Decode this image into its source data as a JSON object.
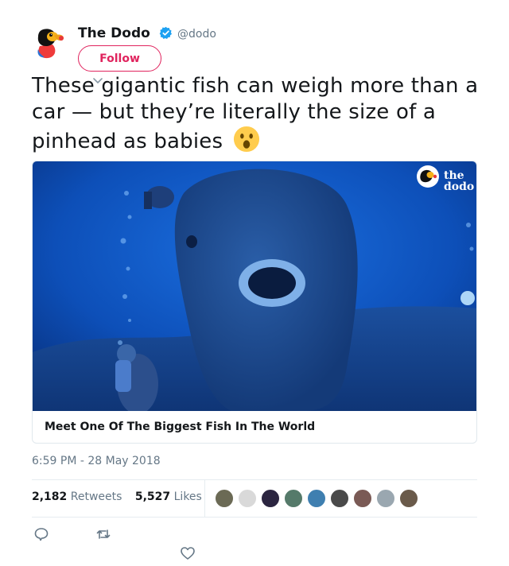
{
  "user": {
    "name": "The Dodo",
    "handle": "@dodo",
    "follow_label": "Follow"
  },
  "tweet": {
    "text": "These gigantic fish can weigh more than a car — but they’re literally the size of a pinhead as babies",
    "emoji": "astonished-face-emoji"
  },
  "card": {
    "title": "Meet One Of The Biggest Fish In The World",
    "watermark": "the dodo"
  },
  "meta": {
    "timestamp": "6:59 PM - 28 May 2018",
    "retweets_count": "2,182",
    "retweets_label": "Retweets",
    "likes_count": "5,527",
    "likes_label": "Likes"
  },
  "likers": [
    {
      "name": "liker-avatar-1",
      "color": "#6b6a55"
    },
    {
      "name": "liker-avatar-2",
      "color": "#d9d9d9"
    },
    {
      "name": "liker-avatar-3",
      "color": "#2b2540"
    },
    {
      "name": "liker-avatar-4",
      "color": "#557a6a"
    },
    {
      "name": "liker-avatar-5",
      "color": "#3f7fb0"
    },
    {
      "name": "liker-avatar-6",
      "color": "#4a4a4a"
    },
    {
      "name": "liker-avatar-7",
      "color": "#7a5a55"
    },
    {
      "name": "liker-avatar-8",
      "color": "#9aa7b0"
    },
    {
      "name": "liker-avatar-9",
      "color": "#6a5a4a"
    }
  ],
  "icons": {
    "reply": "reply-icon",
    "retweet": "retweet-icon",
    "like": "heart-icon"
  },
  "colors": {
    "accent": "#e0245e",
    "secondary_text": "#657786",
    "verified": "#1da1f2"
  }
}
